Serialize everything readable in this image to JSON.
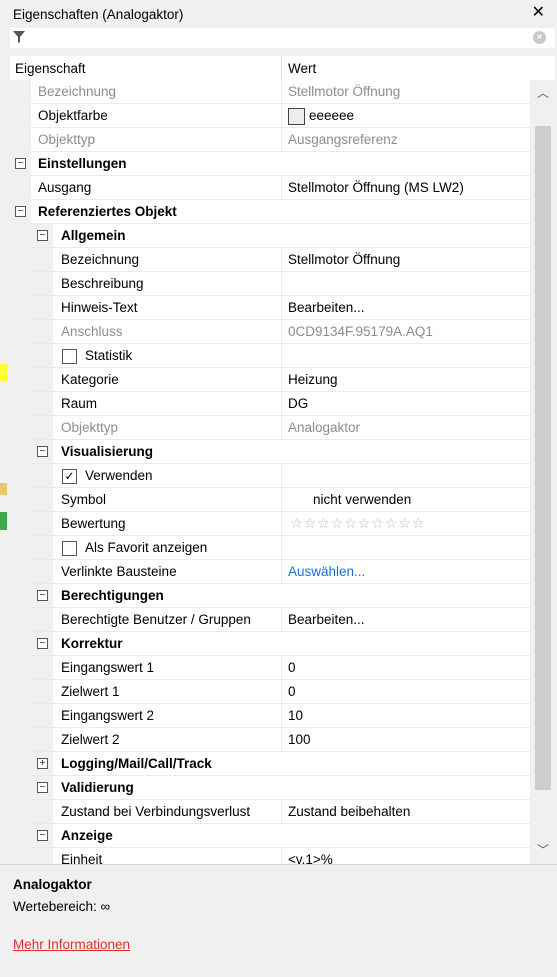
{
  "window": {
    "title": "Eigenschaften (Analogaktor)",
    "close_glyph": "✕"
  },
  "filter": {
    "icon": "funnel-icon",
    "value": ""
  },
  "columns": {
    "property": "Eigenschaft",
    "value": "Wert"
  },
  "rows": [
    {
      "name": "Bezeichnung",
      "value": "Stellmotor Öffnung",
      "level": 1,
      "gray": true
    },
    {
      "name": "Objektfarbe",
      "value": "eeeeee",
      "level": 1,
      "kind": "color",
      "color": "#eeeeee"
    },
    {
      "name": "Objekttyp",
      "value": "Ausgangsreferenz",
      "level": 1,
      "gray": true
    },
    {
      "name": "Einstellungen",
      "level": 0,
      "kind": "section",
      "expanded": true
    },
    {
      "name": "Ausgang",
      "value": "Stellmotor Öffnung (MS LW2)",
      "level": 1
    },
    {
      "name": "Referenziertes Objekt",
      "level": 0,
      "kind": "section",
      "expanded": true
    },
    {
      "name": "Allgemein",
      "level": 1,
      "kind": "section",
      "expanded": true
    },
    {
      "name": "Bezeichnung",
      "value": "Stellmotor Öffnung",
      "level": 2
    },
    {
      "name": "Beschreibung",
      "value": "",
      "level": 2
    },
    {
      "name": "Hinweis-Text",
      "value": "Bearbeiten...",
      "level": 2
    },
    {
      "name": "Anschluss",
      "value": "0CD9134F.95179A.AQ1",
      "level": 2,
      "gray": true
    },
    {
      "name": "Statistik",
      "level": 2,
      "kind": "checkbox",
      "checked": false
    },
    {
      "name": "Kategorie",
      "value": "Heizung",
      "level": 2
    },
    {
      "name": "Raum",
      "value": "DG",
      "level": 2
    },
    {
      "name": "Objekttyp",
      "value": "Analogaktor",
      "level": 2,
      "gray": true
    },
    {
      "name": "Visualisierung",
      "level": 1,
      "kind": "section",
      "expanded": true
    },
    {
      "name": "Verwenden",
      "level": 2,
      "kind": "checkbox",
      "checked": true
    },
    {
      "name": "Symbol",
      "value": "nicht verwenden",
      "level": 2,
      "kind": "symbol"
    },
    {
      "name": "Bewertung",
      "level": 2,
      "kind": "stars",
      "stars": 10,
      "rating": 0
    },
    {
      "name": "Als Favorit anzeigen",
      "level": 2,
      "kind": "checkbox",
      "checked": false
    },
    {
      "name": "Verlinkte Bausteine",
      "value": "Auswählen...",
      "level": 2,
      "kind": "link"
    },
    {
      "name": "Berechtigungen",
      "level": 1,
      "kind": "section",
      "expanded": true
    },
    {
      "name": "Berechtigte Benutzer / Gruppen",
      "value": "Bearbeiten...",
      "level": 2
    },
    {
      "name": "Korrektur",
      "level": 1,
      "kind": "section",
      "expanded": true
    },
    {
      "name": "Eingangswert 1",
      "value": "0",
      "level": 2
    },
    {
      "name": "Zielwert 1",
      "value": "0",
      "level": 2
    },
    {
      "name": "Eingangswert 2",
      "value": "10",
      "level": 2
    },
    {
      "name": "Zielwert 2",
      "value": "100",
      "level": 2
    },
    {
      "name": "Logging/Mail/Call/Track",
      "level": 1,
      "kind": "section",
      "expanded": false
    },
    {
      "name": "Validierung",
      "level": 1,
      "kind": "section",
      "expanded": true
    },
    {
      "name": "Zustand bei Verbindungsverlust",
      "value": "Zustand beibehalten",
      "level": 2
    },
    {
      "name": "Anzeige",
      "level": 1,
      "kind": "section",
      "expanded": true
    },
    {
      "name": "Einheit",
      "value": "<v.1>%",
      "level": 2
    }
  ],
  "help": {
    "title": "Analogaktor",
    "description": "Wertebereich: ∞",
    "link": "Mehr Informationen"
  },
  "colors": {
    "link": "#1a6fd1",
    "help_link": "#e0302e",
    "readonly_text": "#8c8c8c",
    "panel_bg": "#f0f0f0"
  }
}
